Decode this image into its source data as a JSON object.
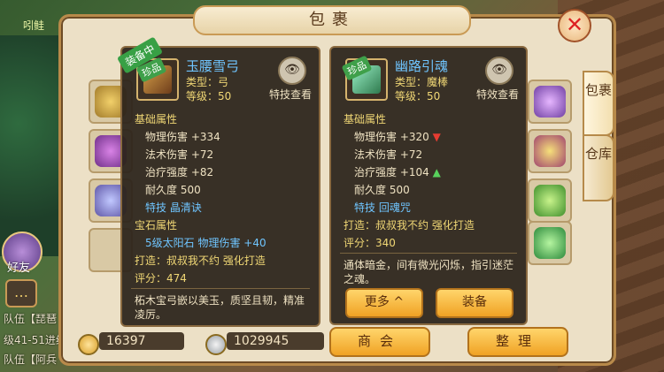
{
  "window": {
    "title": "包裹",
    "close_icon": "close-icon",
    "tabs": [
      "包裹",
      "仓库"
    ]
  },
  "hud": {
    "top_name": "吲鲑",
    "friend_label": "好友",
    "team_lines": [
      "队伍【琵琶",
      "级41-51进线",
      "队伍【阿兵"
    ]
  },
  "left_item": {
    "ribbon": "装备中",
    "badge": "珍品",
    "name": "玉腰雪弓",
    "type": "类型：弓",
    "level": "等级：50",
    "skill_button": "特技查看",
    "base_title": "基础属性",
    "stats": [
      "物理伤害 +334",
      "法术伤害 +72",
      "治疗强度 +82",
      "耐久度 500"
    ],
    "skill": "特技  晶清诀",
    "gem_title": "宝石属性",
    "gem": "5级太阳石  物理伤害 +40",
    "forge": "打造：叔叔我不约   强化打造",
    "score": "评分：474",
    "desc": "柘木宝弓嵌以美玉，质坚且韧，精准凌厉。"
  },
  "right_item": {
    "badge": "珍品",
    "name": "幽路引魂",
    "type": "类型：魔棒",
    "level": "等级：50",
    "effect_button": "特效查看",
    "base_title": "基础属性",
    "stats": [
      "物理伤害 +320",
      "法术伤害 +72",
      "治疗强度 +104",
      "耐久度 500"
    ],
    "skill": "特技  回魂咒",
    "forge": "打造：叔叔我不约   强化打造",
    "score": "评分：340",
    "desc": "通体暗金，间有微光闪烁，指引迷茫之魂。",
    "more_button": "更多 ^",
    "equip_button": "装备"
  },
  "bottom": {
    "gold": "16397",
    "silver": "1029945",
    "shop_button": "商会",
    "sort_button": "整理"
  },
  "colors": {
    "accent": "#f0a224",
    "blue_text": "#6fc5ff",
    "yellow_text": "#f0d775",
    "down": "#e63c31",
    "up": "#58d15c"
  }
}
